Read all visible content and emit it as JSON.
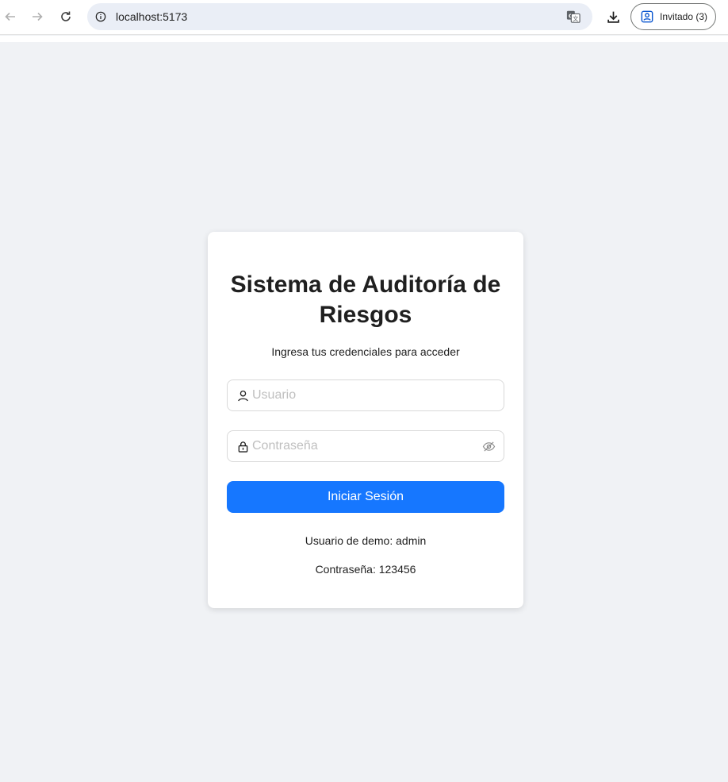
{
  "browser": {
    "url": "localhost:5173",
    "profile_label": "Invitado (3)",
    "icons": {
      "back": "arrow-left-icon",
      "forward": "arrow-right-icon",
      "reload": "reload-icon",
      "site_info": "info-icon",
      "translate": "translate-icon",
      "download": "download-icon",
      "profile": "profile-icon"
    }
  },
  "login": {
    "title": "Sistema de Auditoría de Riesgos",
    "subtitle": "Ingresa tus credenciales para acceder",
    "username_placeholder": "Usuario",
    "username_value": "",
    "password_placeholder": "Contraseña",
    "password_value": "",
    "submit_label": "Iniciar Sesión",
    "demo_user": "Usuario de demo: admin",
    "demo_password": "Contraseña: 123456"
  },
  "colors": {
    "page_background": "#f0f2f5",
    "primary": "#1677ff",
    "card": "#ffffff"
  }
}
